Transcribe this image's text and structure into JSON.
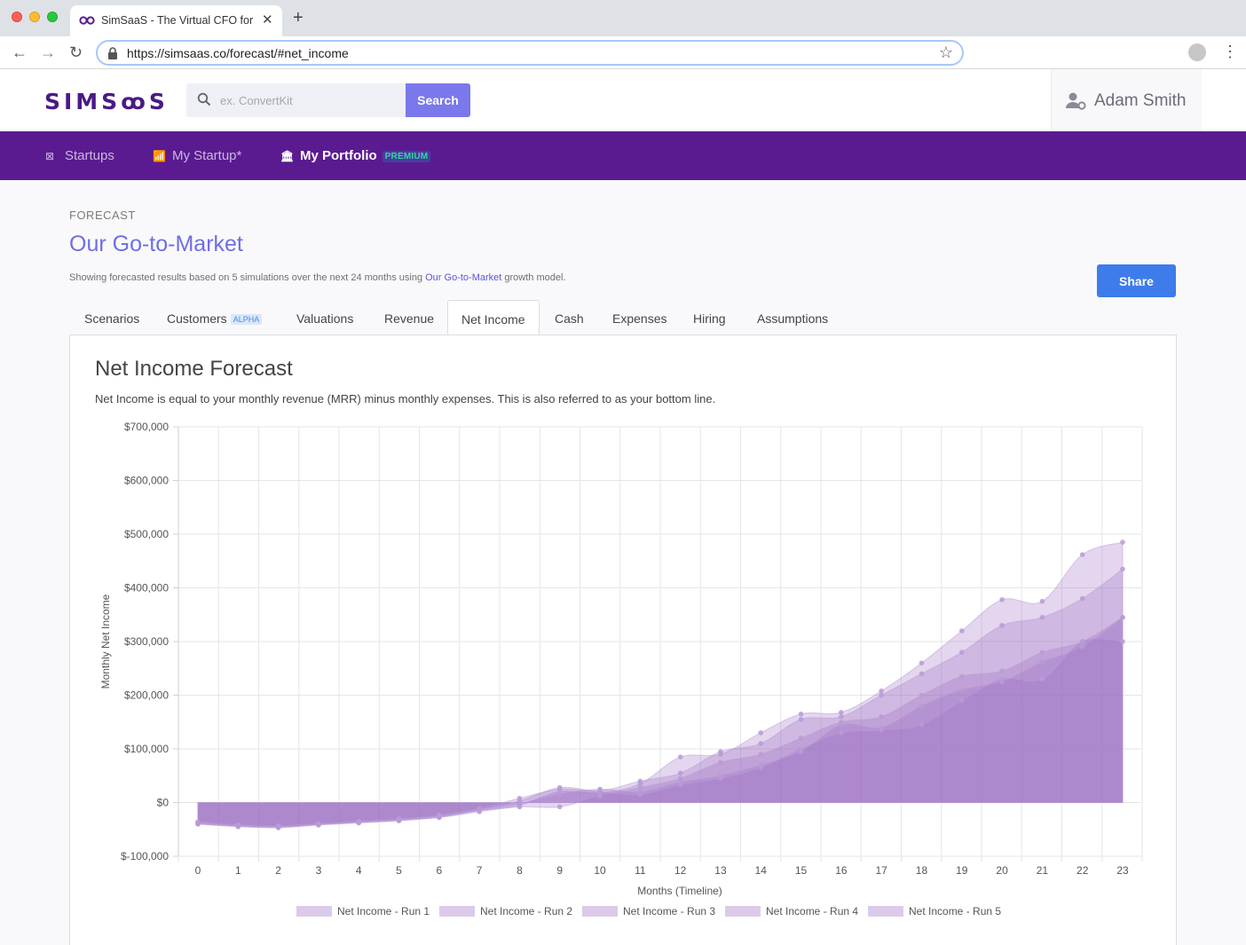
{
  "browser": {
    "tab_title": "SimSaaS - The Virtual CFO for",
    "close_glyph": "✕",
    "new_tab_glyph": "+",
    "url": "https://simsaas.co/forecast/#net_income",
    "back_glyph": "←",
    "forward_glyph": "→",
    "reload_glyph": "↻",
    "bookmark_glyph": "☆",
    "menu_glyph": "⋮"
  },
  "header": {
    "logo": "SIMSꝏS",
    "search_placeholder": "ex. ConvertKit",
    "search_button": "Search",
    "user_name": "Adam Smith"
  },
  "nav": {
    "items": [
      {
        "label": "Startups",
        "icon": "grid-icon"
      },
      {
        "label": "My Startup*",
        "icon": "bar-chart-icon"
      },
      {
        "label": "My Portfolio",
        "icon": "bank-icon",
        "badge": "PREMIUM"
      }
    ]
  },
  "page": {
    "eyebrow": "FORECAST",
    "title": "Our Go-to-Market",
    "subtitle_prefix": "Showing forecasted results based on 5 simulations over the next 24 months using ",
    "subtitle_link": "Our Go-to-Market",
    "subtitle_suffix": " growth model.",
    "share_button": "Share"
  },
  "tabs": [
    {
      "label": "Scenarios"
    },
    {
      "label": "Customers",
      "badge": "ALPHA"
    },
    {
      "label": "Valuations"
    },
    {
      "label": "Revenue"
    },
    {
      "label": "Net Income",
      "active": true
    },
    {
      "label": "Cash"
    },
    {
      "label": "Expenses"
    },
    {
      "label": "Hiring"
    },
    {
      "label": "Assumptions"
    }
  ],
  "panel": {
    "title": "Net Income Forecast",
    "description": "Net Income is equal to your monthly revenue (MRR) minus monthly expenses. This is also referred to as your bottom line."
  },
  "chart_data": {
    "type": "area",
    "xlabel": "Months (Timeline)",
    "ylabel": "Monthly Net Income",
    "x": [
      0,
      1,
      2,
      3,
      4,
      5,
      6,
      7,
      8,
      9,
      10,
      11,
      12,
      13,
      14,
      15,
      16,
      17,
      18,
      19,
      20,
      21,
      22,
      23
    ],
    "ylim": [
      -100000,
      700000
    ],
    "yticks": [
      -100000,
      0,
      100000,
      200000,
      300000,
      400000,
      500000,
      600000,
      700000
    ],
    "ytick_labels": [
      "$-100,000",
      "$0",
      "$100,000",
      "$200,000",
      "$300,000",
      "$400,000",
      "$500,000",
      "$600,000",
      "$700,000"
    ],
    "grid": true,
    "legend_position": "bottom",
    "colors": {
      "fill": "#9b6cc3",
      "fill_opacity": 0.28,
      "point": "#b89ad6",
      "legend_box": "#dccaea"
    },
    "series": [
      {
        "name": "Net Income - Run 1",
        "values": [
          -40000,
          -44000,
          -46000,
          -41000,
          -37000,
          -33000,
          -27000,
          -15000,
          -5000,
          20000,
          18000,
          35000,
          85000,
          90000,
          130000,
          165000,
          168000,
          208000,
          260000,
          320000,
          378000,
          375000,
          462000,
          485000
        ]
      },
      {
        "name": "Net Income - Run 2",
        "values": [
          -38000,
          -42000,
          -44000,
          -40000,
          -36000,
          -31000,
          -24000,
          -12000,
          3000,
          28000,
          22000,
          40000,
          55000,
          95000,
          110000,
          155000,
          160000,
          200000,
          240000,
          280000,
          330000,
          345000,
          380000,
          435000
        ]
      },
      {
        "name": "Net Income - Run 3",
        "values": [
          -40000,
          -45000,
          -47000,
          -42000,
          -38000,
          -34000,
          -28000,
          -17000,
          -8000,
          -8000,
          12000,
          28000,
          45000,
          75000,
          90000,
          120000,
          150000,
          160000,
          200000,
          235000,
          245000,
          280000,
          300000,
          345000
        ]
      },
      {
        "name": "Net Income - Run 4",
        "values": [
          -38000,
          -43000,
          -45000,
          -40000,
          -36000,
          -32000,
          -26000,
          -14000,
          -2000,
          15000,
          25000,
          20000,
          38000,
          50000,
          70000,
          95000,
          145000,
          140000,
          180000,
          210000,
          225000,
          262000,
          290000,
          345000
        ]
      },
      {
        "name": "Net Income - Run 5",
        "values": [
          -36000,
          -41000,
          -43000,
          -39000,
          -35000,
          -30000,
          -23000,
          -11000,
          8000,
          25000,
          20000,
          15000,
          33000,
          45000,
          65000,
          100000,
          130000,
          135000,
          145000,
          190000,
          230000,
          230000,
          300000,
          300000
        ]
      }
    ]
  }
}
